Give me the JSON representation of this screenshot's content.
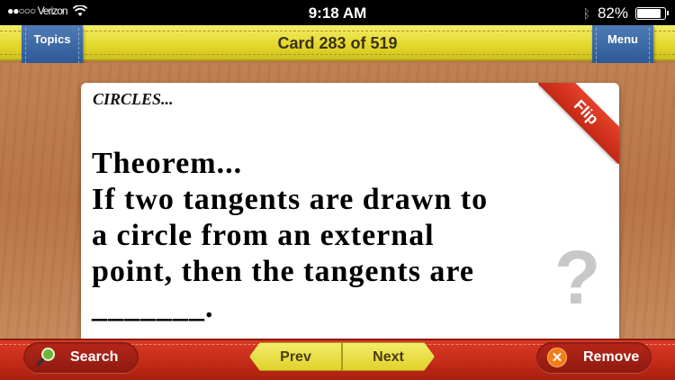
{
  "status_bar": {
    "carrier": "●●○○○ Verizon",
    "time": "9:18 AM",
    "battery": "82%"
  },
  "header": {
    "card_counter": "Card 283 of 519",
    "topics_label": "Topics",
    "menu_label": "Menu"
  },
  "card": {
    "topic": "CIRCLES...",
    "text": "Theorem...\nIf two tangents are drawn to\na circle from an external\npoint, then the tangents are\n_______.",
    "flip_label": "Flip",
    "question_mark": "?"
  },
  "footer": {
    "search_label": "Search",
    "prev_label": "Prev",
    "next_label": "Next",
    "remove_label": "Remove"
  },
  "colors": {
    "top_bar": "#e3d72a",
    "ribbon": "#2d5a97",
    "bottom_bar": "#c22a17",
    "flip_corner": "#d9331e",
    "wood": "#b87548"
  }
}
